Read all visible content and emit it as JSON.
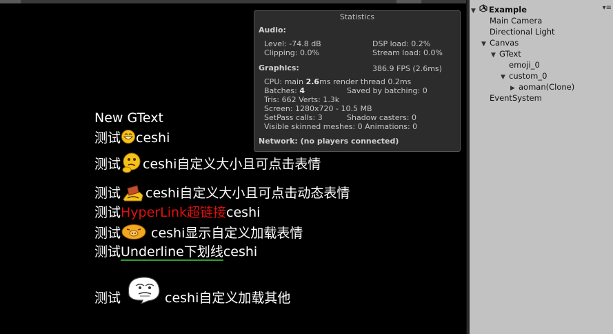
{
  "stats": {
    "title": "Statistics",
    "audio_header": "Audio:",
    "level": "Level: -74.8 dB",
    "clipping": "Clipping: 0.0%",
    "dsp": "DSP load: 0.2%",
    "stream": "Stream load: 0.0%",
    "graphics_header": "Graphics:",
    "fps": "386.9 FPS (2.6ms)",
    "cpu_a": "CPU: main ",
    "cpu_b": "2.6",
    "cpu_c": "ms  render thread 0.2ms",
    "batches_a": "Batches: ",
    "batches_b": "4",
    "saved": "Saved by batching: 0",
    "tris": "Tris: 662  Verts: 1.3k",
    "screen": "Screen: 1280x720 - 10.5 MB",
    "setpass": "SetPass calls: 3",
    "shadow": "Shadow casters: 0",
    "skinned": "Visible skinned meshes: 0  Animations: 0",
    "network": "Network: (no players connected)"
  },
  "gtext": {
    "line1": "New GText",
    "line2_a": "测试",
    "line2_b": "ceshi",
    "line3_a": "测试",
    "line3_b": "ceshi自定义大小且可点击表情",
    "line4_a": "测试",
    "line4_b": "ceshi自定义大小且可点击动态表情",
    "line5_a": "测试",
    "line5_link": "HyperLink超链接",
    "line5_b": "ceshi",
    "line6_a": "测试",
    "line6_b": "ceshi显示自定义加载表情",
    "line7_a": "测试",
    "line7_ul": "Underline下划线",
    "line7_b": "ceshi",
    "line8_a": "测试",
    "line8_b": "ceshi自定义加载其他"
  },
  "hierarchy": {
    "scene": "Example",
    "menu_icon": "▾≡",
    "items": [
      "Main Camera",
      "Directional Light",
      "Canvas",
      "GText",
      "emoji_0",
      "custom_0",
      "aoman(Clone)",
      "EventSystem"
    ]
  },
  "icons": [
    "unity-scene-icon",
    "grin-emoji-icon",
    "thinking-emoji-icon",
    "bowing-emoji-icon",
    "pig-emoji-icon",
    "rage-face-icon"
  ]
}
